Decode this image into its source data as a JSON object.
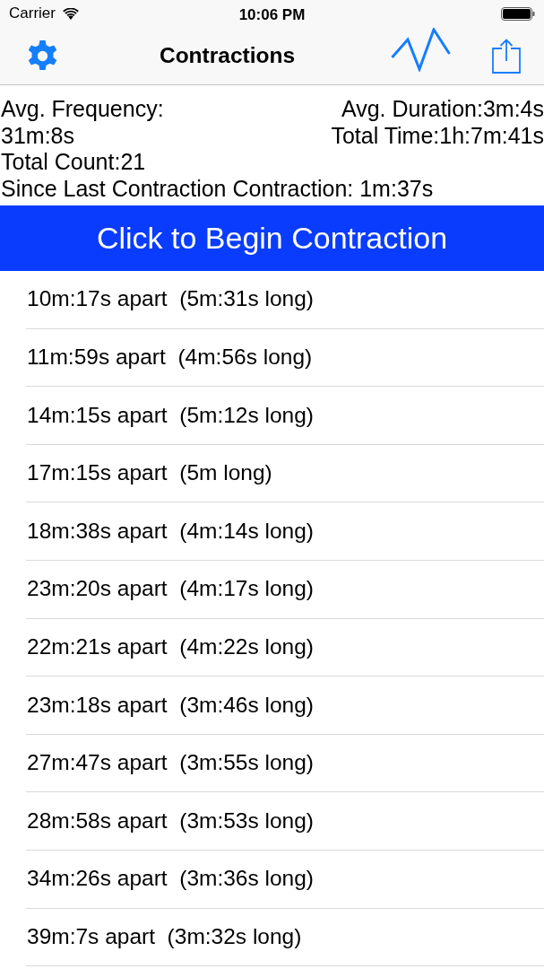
{
  "status_bar": {
    "carrier": "Carrier",
    "time": "10:06 PM"
  },
  "nav_bar": {
    "title": "Contractions"
  },
  "stats": {
    "avg_frequency": {
      "label": "Avg. Frequency:",
      "value": "31m:8s"
    },
    "avg_duration": "Avg. Duration:3m:4s",
    "total_time": "Total Time:1h:7m:41s",
    "total_count": "Total Count:21",
    "since_last": "Since Last Contraction Contraction: 1m:37s"
  },
  "begin_button": {
    "label": "Click to Begin Contraction"
  },
  "contractions": [
    "10m:17s apart  (5m:31s long)",
    "11m:59s apart  (4m:56s long)",
    "14m:15s apart  (5m:12s long)",
    "17m:15s apart  (5m long)",
    "18m:38s apart  (4m:14s long)",
    "23m:20s apart  (4m:17s long)",
    "22m:21s apart  (4m:22s long)",
    "23m:18s apart  (3m:46s long)",
    "27m:47s apart  (3m:55s long)",
    "28m:58s apart  (3m:53s long)",
    "34m:26s apart  (3m:36s long)",
    "39m:7s apart  (3m:32s long)"
  ]
}
